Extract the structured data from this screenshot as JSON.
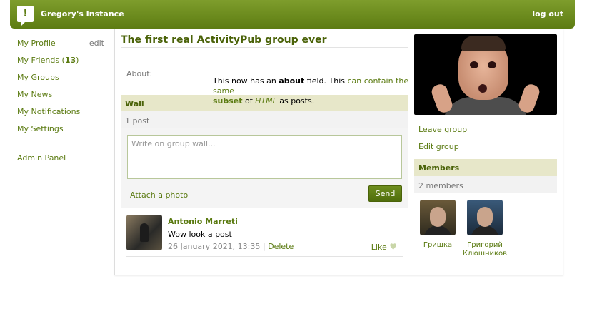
{
  "header": {
    "logo_glyph": "!",
    "site_title": "Gregory's Instance",
    "logout_label": "log out",
    "bar_color": "#6b8a1f"
  },
  "sidebar": {
    "items": [
      {
        "label": "My Profile",
        "action": "edit"
      },
      {
        "label": "My Friends",
        "count": "13"
      },
      {
        "label": "My Groups"
      },
      {
        "label": "My News"
      },
      {
        "label": "My Notifications"
      },
      {
        "label": "My Settings"
      }
    ],
    "admin_label": "Admin Panel"
  },
  "group": {
    "title": "The first real ActivityPub group ever",
    "about_label": "About:",
    "about_parts": {
      "p1": "This now has an ",
      "b1": "about",
      "p2": " field. This ",
      "link1": "can contain the same",
      "b2": "subset",
      "p3": " of ",
      "i1": "HTML",
      "p4": " as posts."
    }
  },
  "wall": {
    "title": "Wall",
    "count_text": "1 post",
    "placeholder": "Write on group wall...",
    "attach_label": "Attach a photo",
    "send_label": "Send",
    "posts": [
      {
        "author": "Antonio Marreti",
        "text": "Wow look a post",
        "date": "26 January 2021, 13:35",
        "separator": "|",
        "delete_label": "Delete",
        "like_label": "Like",
        "like_icon": "heart-icon"
      }
    ]
  },
  "right": {
    "leave_label": "Leave group",
    "edit_label": "Edit group",
    "members_title": "Members",
    "members_count_text": "2 members",
    "members": [
      {
        "name_line1": "Гришка",
        "name_line2": ""
      },
      {
        "name_line1": "Григорий",
        "name_line2": "Клюшников"
      }
    ]
  },
  "colors": {
    "accent": "#5a7a10",
    "section_bg": "#e7e7c9",
    "sub_bg": "#f2f2f2"
  }
}
